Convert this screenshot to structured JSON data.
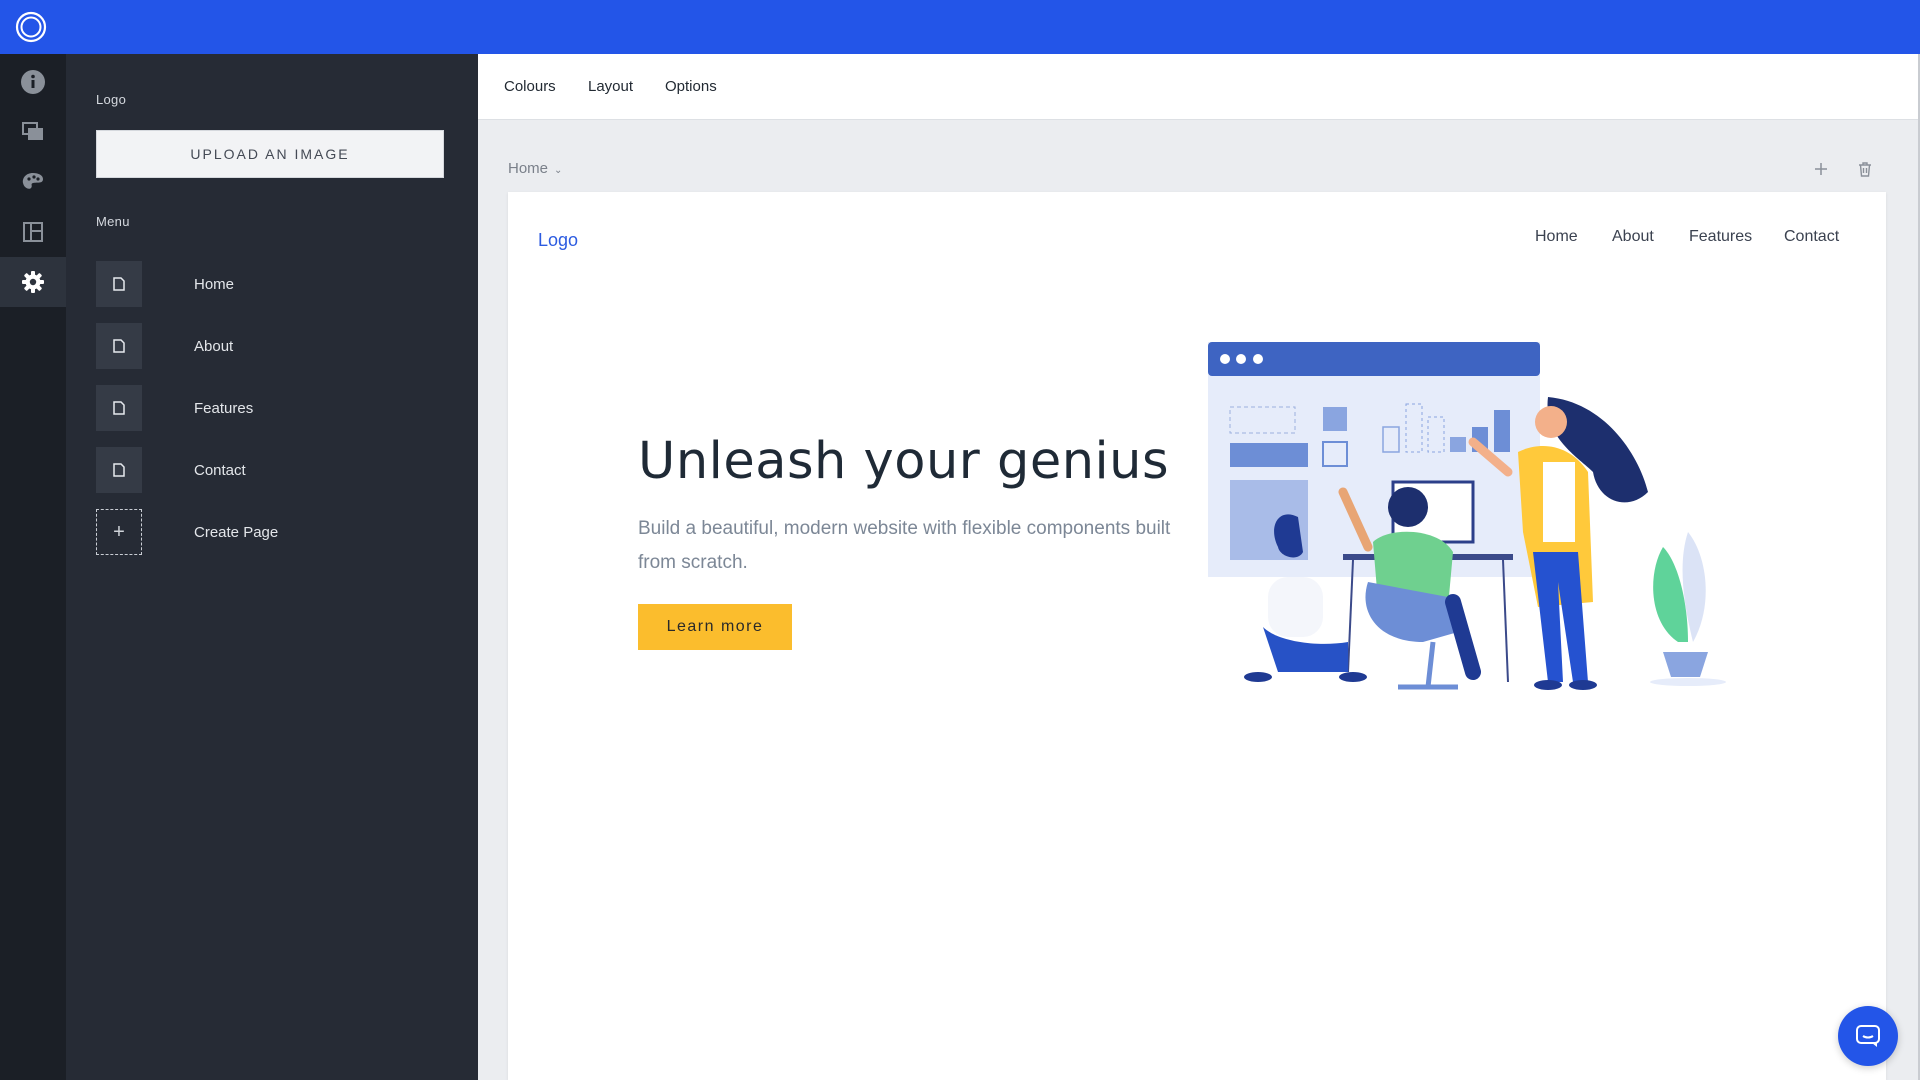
{
  "app": {
    "brand_icon": "concentric-circles-logo-icon",
    "accent_color": "#2355e8"
  },
  "rail": {
    "items": [
      {
        "icon": "info-icon"
      },
      {
        "icon": "pages-icon"
      },
      {
        "icon": "palette-icon"
      },
      {
        "icon": "layout-icon"
      },
      {
        "icon": "gear-icon",
        "active": true
      }
    ]
  },
  "panel": {
    "logo_label": "Logo",
    "upload_label": "UPLOAD AN IMAGE",
    "menu_label": "Menu",
    "menu_items": [
      {
        "label": "Home",
        "icon": "page-icon"
      },
      {
        "label": "About",
        "icon": "page-icon"
      },
      {
        "label": "Features",
        "icon": "page-icon"
      },
      {
        "label": "Contact",
        "icon": "page-icon"
      }
    ],
    "create_page_label": "Create Page",
    "create_page_glyph": "+"
  },
  "main": {
    "tabs": [
      "Colours",
      "Layout",
      "Options"
    ],
    "breadcrumb": "Home",
    "breadcrumb_chevron": "⌄"
  },
  "preview": {
    "logo": "Logo",
    "nav": [
      "Home",
      "About",
      "Features",
      "Contact"
    ],
    "hero_title": "Unleash your genius",
    "hero_subtitle": "Build a beautiful, modern website with flexible components built from scratch.",
    "cta_label": "Learn more",
    "cta_color": "#fbbd2d"
  },
  "chat": {
    "icon": "chat-bubble-icon"
  }
}
